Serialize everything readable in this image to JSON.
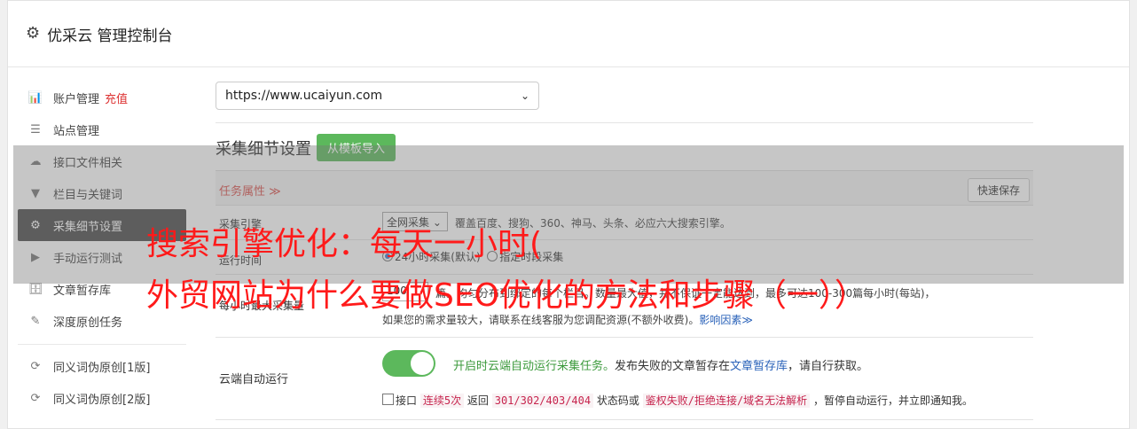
{
  "app": {
    "title": "优采云 管理控制台"
  },
  "sidebar": {
    "items": [
      {
        "label": "账户管理",
        "badge": "充值",
        "icon": "bar-chart-icon",
        "glyph": "📊"
      },
      {
        "label": "站点管理",
        "icon": "server-icon",
        "glyph": "☰"
      },
      {
        "label": "接口文件相关",
        "icon": "cloud-upload-icon",
        "glyph": "☁"
      },
      {
        "label": "栏目与关键词",
        "icon": "filter-icon",
        "glyph": "▼"
      },
      {
        "label": "采集细节设置",
        "icon": "cogs-icon",
        "glyph": "⚙",
        "active": true
      },
      {
        "label": "手动运行测试",
        "icon": "play-icon",
        "glyph": "▶"
      },
      {
        "label": "文章暂存库",
        "icon": "database-icon",
        "glyph": "🗄"
      },
      {
        "label": "深度原创任务",
        "icon": "edit-icon",
        "glyph": "✎"
      },
      {
        "label": "同义词伪原创[1版]",
        "icon": "refresh-icon",
        "glyph": "⟳"
      },
      {
        "label": "同义词伪原创[2版]",
        "icon": "refresh-icon",
        "glyph": "⟳"
      }
    ]
  },
  "main": {
    "site_select": "https://www.ucaiyun.com",
    "section_title": "采集细节设置",
    "import_button": "从模板导入",
    "task_attr_label": "任务属性 ≫",
    "quick_save_button": "快速保存",
    "engine": {
      "label": "采集引擎",
      "selected": "全网采集",
      "desc": "覆盖百度、搜狗、360、神马、头条、必应六大搜索引擎。"
    },
    "run_time": {
      "label": "运行时间",
      "option1": "24小时采集(默认)",
      "option2": "指定时段采集"
    },
    "max_collect": {
      "label": "每小时最大采集量",
      "value": "100",
      "desc": "篇。均匀分布到绑定的每个栏目。数量最大值，并不保证一定能达到，最多可达100-300篇每小时(每站)，",
      "desc2": "如果您的需求量较大，请联系在线客服为您调配资源(不额外收费)。",
      "link": "影响因素≫"
    },
    "cloud": {
      "label": "云端自动运行",
      "on_text": "开启时云端自动运行采集任务。",
      "desc": "发布失败的文章暂存在",
      "link": "文章暂存库",
      "desc_end": "，请自行获取。",
      "line2_a": "接口",
      "code1": "连续5次",
      "line2_b": " 返回 ",
      "code2": "301/302/403/404",
      "line2_c": " 状态码或 ",
      "code3": "鉴权失败/拒绝连接/域名无法解析",
      "line2_d": " ，暂停自动运行，并立即通知我。"
    }
  },
  "overlay": {
    "line1": "搜索引擎优化：每天一小时(",
    "line2": "外贸网站为什么要做SEO优化的方法和步骤（一））"
  },
  "colors": {
    "accent_green": "#5cb85c",
    "overlay_red": "#ff1a1a",
    "active_nav": "#4b4b4b"
  }
}
